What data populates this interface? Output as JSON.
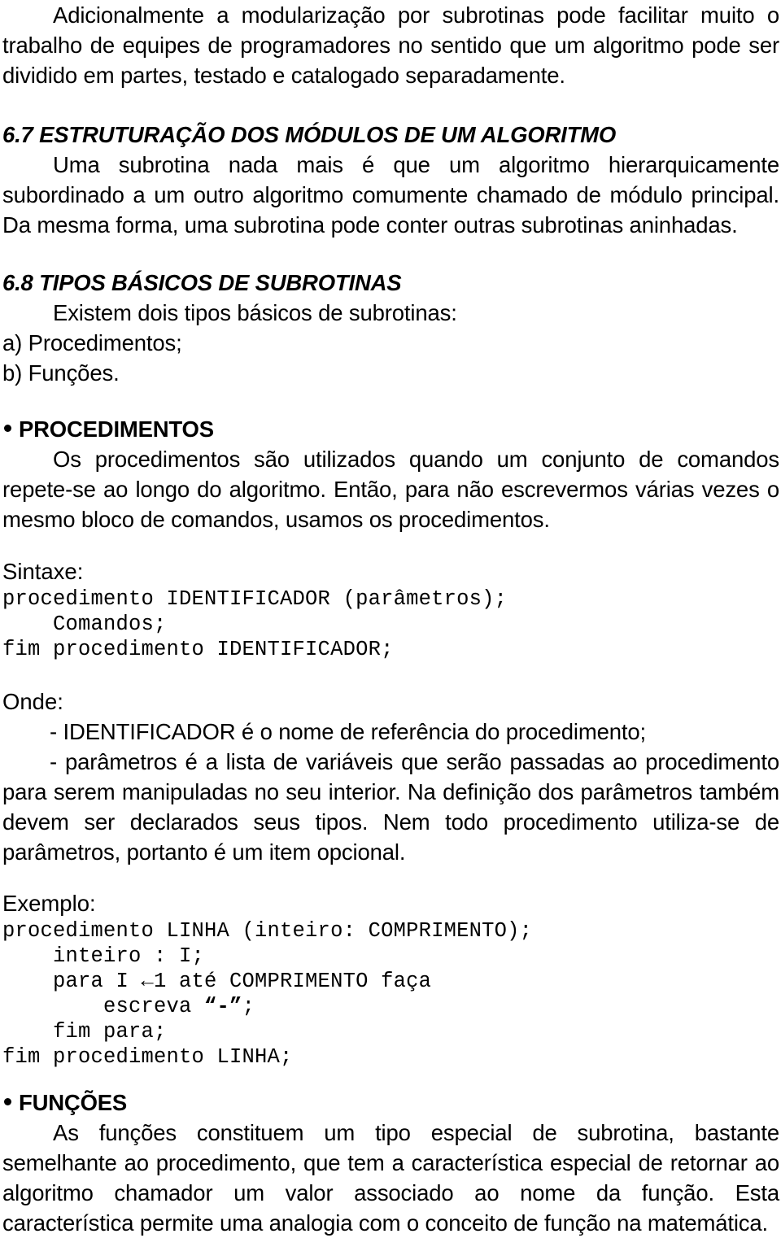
{
  "document": {
    "paragraphs": {
      "intro": "Adicionalmente a modularização por subrotinas pode facilitar muito o trabalho de equipes de programadores no sentido que um algoritmo pode ser dividido em partes, testado e catalogado separadamente."
    },
    "sections": [
      {
        "heading": "6.7 ESTRUTURAÇÃO DOS MÓDULOS DE UM ALGORITMO",
        "body": "Uma subrotina nada mais é que um algoritmo hierarquicamente subordinado a um outro algoritmo comumente chamado de módulo principal. Da mesma forma, uma subrotina pode conter outras subrotinas aninhadas."
      },
      {
        "heading": "6.8 TIPOS BÁSICOS DE SUBROTINAS",
        "body": "Existem dois tipos básicos de subrotinas:",
        "list": [
          "a) Procedimentos;",
          "b) Funções."
        ]
      }
    ],
    "procedimentos": {
      "bullet_title": "PROCEDIMENTOS",
      "body": "Os procedimentos são utilizados quando um conjunto de comandos repete-se ao longo do algoritmo. Então, para não escrevermos várias vezes o mesmo bloco de comandos, usamos os procedimentos.",
      "sintaxe_label": "Sintaxe:",
      "sintaxe_code": [
        "procedimento IDENTIFICADOR (parâmetros);",
        "    Comandos;",
        "fim procedimento IDENTIFICADOR;"
      ],
      "onde_label": "Onde:",
      "onde_items": [
        "- IDENTIFICADOR é o nome de referência do procedimento;",
        "- parâmetros é a lista de variáveis que serão passadas ao procedimento para serem manipuladas no seu interior. Na definição dos parâmetros também devem ser declarados seus tipos. Nem todo procedimento utiliza-se de parâmetros, portanto é um item opcional."
      ],
      "exemplo_label": "Exemplo:",
      "exemplo_code_lines": [
        "procedimento LINHA (inteiro: COMPRIMENTO);",
        "    inteiro : I;",
        "    para I ←1 até COMPRIMENTO faça",
        "        escreva “-”;",
        "    fim para;",
        "fim procedimento LINHA;"
      ],
      "exemplo_code_parts": {
        "line1": "procedimento LINHA (inteiro: COMPRIMENTO);",
        "line2": "    inteiro : I;",
        "line3": "    para I ←1 até COMPRIMENTO faça",
        "line4_prefix": "        escreva ",
        "line4_quoted": "“-”",
        "line4_suffix": ";",
        "line5": "    fim para;",
        "line6": "fim procedimento LINHA;"
      }
    },
    "funcoes": {
      "bullet_title": "FUNÇÕES",
      "body": "As funções constituem um tipo especial de subrotina, bastante semelhante ao procedimento, que tem a característica especial de retornar ao algoritmo chamador um valor associado ao nome da função. Esta característica permite uma analogia com o conceito de função na matemática."
    }
  }
}
